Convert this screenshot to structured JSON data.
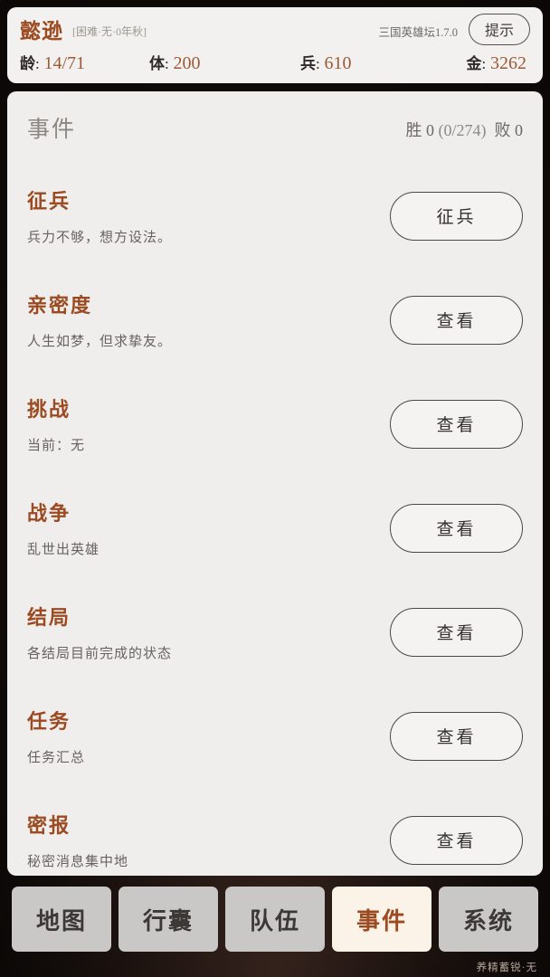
{
  "header": {
    "player_name": "懿逊",
    "player_meta": "[困难·无·0年秋]",
    "version": "三国英雄坛1.7.0",
    "hint_label": "提示",
    "stats": [
      {
        "key": "龄",
        "sep": ":",
        "value": "14/71"
      },
      {
        "key": "体",
        "sep": ":",
        "value": "200"
      },
      {
        "key": "兵",
        "sep": ":",
        "value": "610"
      },
      {
        "key": "金",
        "sep": ":",
        "value": "3262"
      }
    ]
  },
  "panel": {
    "title": "事件",
    "score_win_label": "胜",
    "score_win_value": "0",
    "score_progress": "(0/274)",
    "score_loss_label": "败",
    "score_loss_value": "0",
    "events": [
      {
        "title": "征兵",
        "desc": "兵力不够，想方设法。",
        "button": "征兵"
      },
      {
        "title": "亲密度",
        "desc": "人生如梦，但求挚友。",
        "button": "查看"
      },
      {
        "title": "挑战",
        "desc": "当前：无",
        "button": "查看"
      },
      {
        "title": "战争",
        "desc": "乱世出英雄",
        "button": "查看"
      },
      {
        "title": "结局",
        "desc": "各结局目前完成的状态",
        "button": "查看"
      },
      {
        "title": "任务",
        "desc": "任务汇总",
        "button": "查看"
      },
      {
        "title": "密报",
        "desc": "秘密消息集中地",
        "button": "查看"
      }
    ]
  },
  "nav": {
    "items": [
      {
        "label": "地图",
        "active": false
      },
      {
        "label": "行囊",
        "active": false
      },
      {
        "label": "队伍",
        "active": false
      },
      {
        "label": "事件",
        "active": true
      },
      {
        "label": "系统",
        "active": false
      }
    ]
  },
  "footer": {
    "status_note": "养精蓄锐·无"
  },
  "colors": {
    "accent": "#9b4a21",
    "value": "#9b5a35",
    "card": "#f0efed",
    "nav": "#c9c8c6",
    "nav_active": "#fbf2e8",
    "backdrop": "#140f0d"
  }
}
